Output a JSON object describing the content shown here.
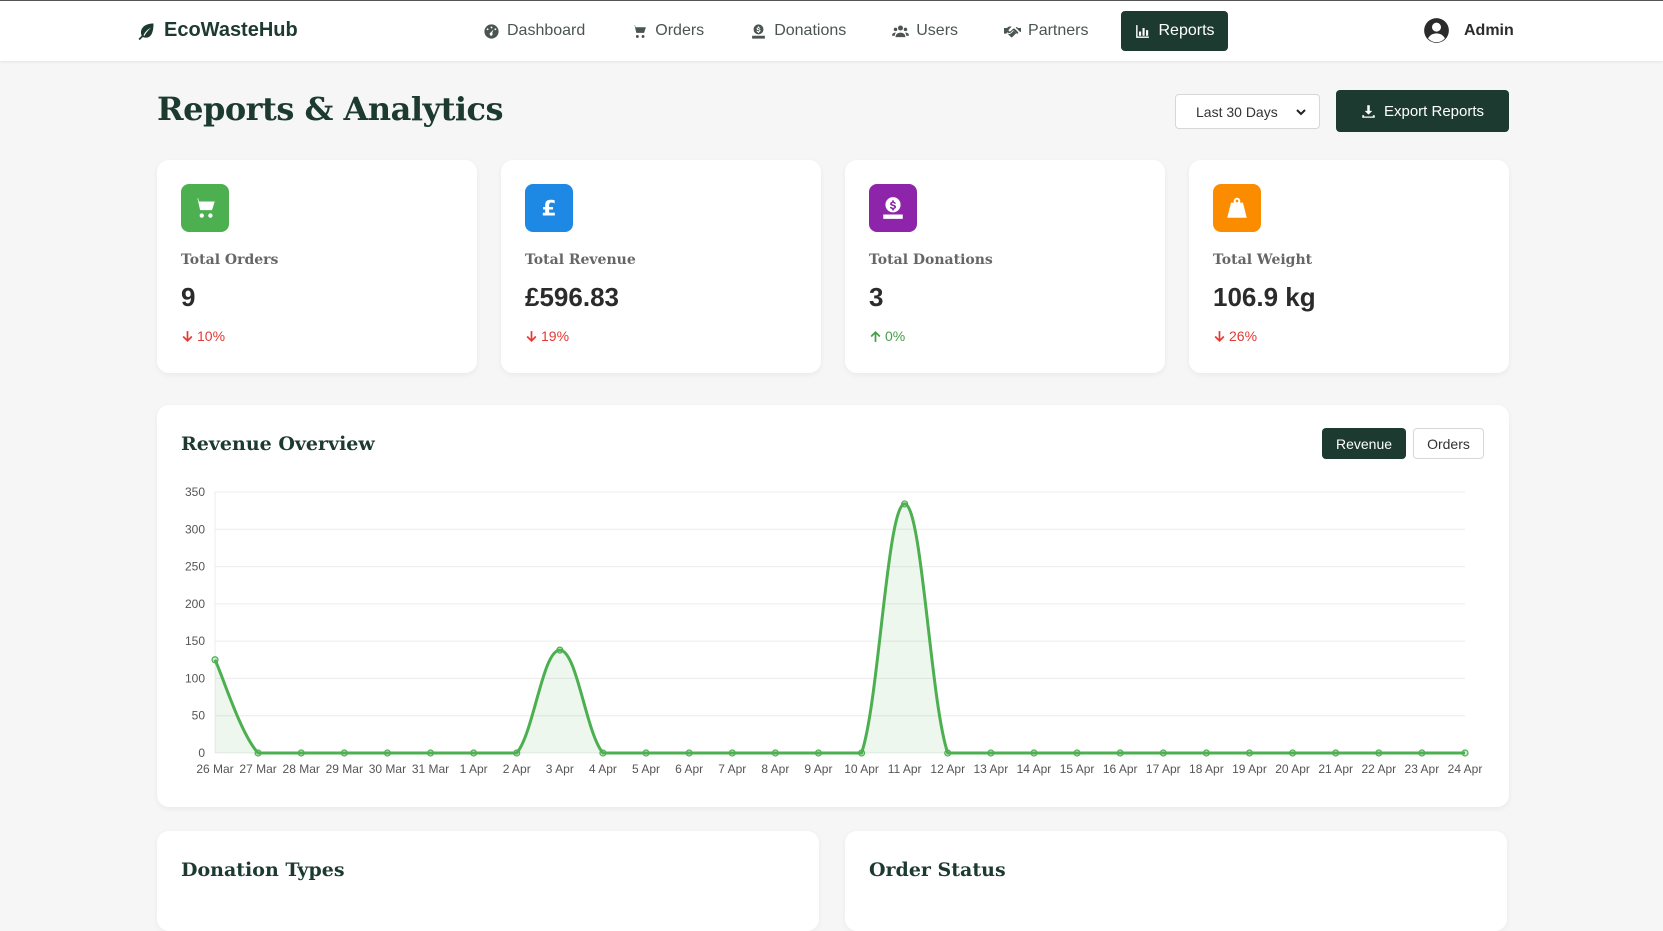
{
  "brand": {
    "name": "EcoWasteHub",
    "icon": "leaf-icon"
  },
  "nav": {
    "items": [
      {
        "label": "Dashboard",
        "icon": "dashboard-icon"
      },
      {
        "label": "Orders",
        "icon": "cart-icon"
      },
      {
        "label": "Donations",
        "icon": "donation-icon"
      },
      {
        "label": "Users",
        "icon": "users-icon"
      },
      {
        "label": "Partners",
        "icon": "handshake-icon"
      },
      {
        "label": "Reports",
        "icon": "chart-icon",
        "active": true
      }
    ]
  },
  "user": {
    "name": "Admin",
    "icon": "user-circle-icon"
  },
  "page": {
    "title": "Reports & Analytics",
    "range_selected": "Last 30 Days",
    "export_label": "Export Reports"
  },
  "stats": [
    {
      "label": "Total Orders",
      "value": "9",
      "change": "10%",
      "direction": "down",
      "icon": "cart-icon",
      "color": "#4caf50"
    },
    {
      "label": "Total Revenue",
      "value": "£596.83",
      "change": "19%",
      "direction": "down",
      "icon": "pound-icon",
      "color": "#1e88e5"
    },
    {
      "label": "Total Donations",
      "value": "3",
      "change": "0%",
      "direction": "up",
      "icon": "donation-icon",
      "color": "#8e24aa"
    },
    {
      "label": "Total Weight",
      "value": "106.9 kg",
      "change": "26%",
      "direction": "down",
      "icon": "weight-icon",
      "color": "#fb8c00"
    }
  ],
  "colors": {
    "primary": "#1d3a30",
    "down": "#e53935",
    "up": "#43a047",
    "line": "#4caf50"
  },
  "revenue": {
    "title": "Revenue Overview",
    "toggle_revenue": "Revenue",
    "toggle_orders": "Orders"
  },
  "chart_data": {
    "type": "line",
    "x": [
      "26 Mar",
      "27 Mar",
      "28 Mar",
      "29 Mar",
      "30 Mar",
      "31 Mar",
      "1 Apr",
      "2 Apr",
      "3 Apr",
      "4 Apr",
      "5 Apr",
      "6 Apr",
      "7 Apr",
      "8 Apr",
      "9 Apr",
      "10 Apr",
      "11 Apr",
      "12 Apr",
      "13 Apr",
      "14 Apr",
      "15 Apr",
      "16 Apr",
      "17 Apr",
      "18 Apr",
      "19 Apr",
      "20 Apr",
      "21 Apr",
      "22 Apr",
      "23 Apr",
      "24 Apr"
    ],
    "series": [
      {
        "values": [
          125,
          0,
          0,
          0,
          0,
          0,
          0,
          0,
          138,
          0,
          0,
          0,
          0,
          0,
          0,
          0,
          334,
          0,
          0,
          0,
          0,
          0,
          0,
          0,
          0,
          0,
          0,
          0,
          0,
          0
        ]
      }
    ],
    "ylim": [
      0,
      350
    ],
    "yticks": [
      0,
      50,
      100,
      150,
      200,
      250,
      300,
      350
    ],
    "grid": true,
    "fill": true
  },
  "bottom": {
    "donation_types_title": "Donation Types",
    "order_status_title": "Order Status"
  }
}
